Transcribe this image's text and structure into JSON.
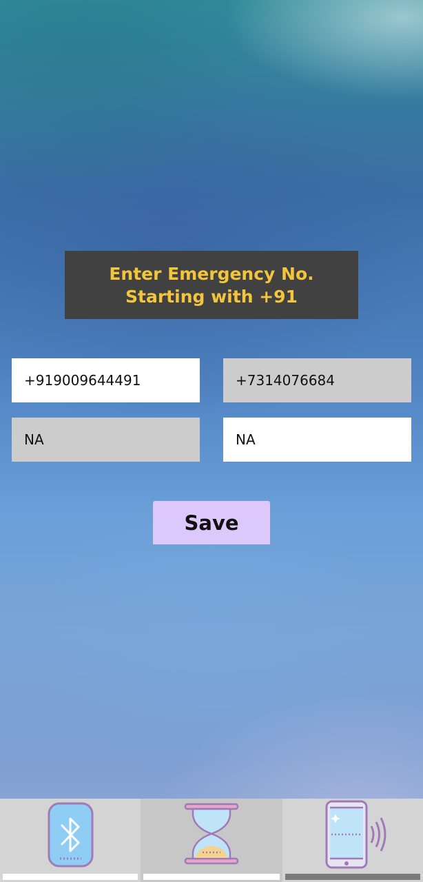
{
  "header": {
    "line1": "Enter Emergency No.",
    "line2": "Starting with +91"
  },
  "contacts": {
    "field1": "+919009644491",
    "field2": "+7314076684",
    "field3": "NA",
    "field4": "NA"
  },
  "save_button": {
    "label": "Save",
    "color": "#dcc8fb"
  },
  "bottom_nav": {
    "tabs": [
      {
        "icon": "bluetooth-phone-icon",
        "active": false
      },
      {
        "icon": "hourglass-icon",
        "active": false
      },
      {
        "icon": "phone-vibration-icon",
        "active": true
      }
    ]
  },
  "colors": {
    "title_text": "#f2c53d",
    "title_box": "#414141",
    "icon_stroke": "#a07ab8"
  }
}
